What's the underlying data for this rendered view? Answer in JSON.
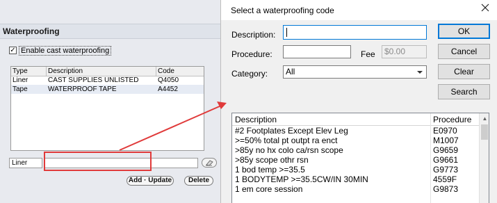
{
  "left_panel": {
    "section_title": "Waterproofing",
    "enable_checkbox": {
      "checked": true,
      "mark": "✓",
      "label": "Enable cast waterproofing"
    },
    "table": {
      "columns": [
        "Type",
        "Description",
        "Code"
      ],
      "rows": [
        {
          "type": "Liner",
          "description": "CAST SUPPLIES UNLISTED",
          "code": "Q4050"
        },
        {
          "type": "Tape",
          "description": "WATERPROOF TAPE",
          "code": "A4452"
        }
      ]
    },
    "type_value": "Liner",
    "description_value": "",
    "buttons": {
      "add_update": "Add · Update",
      "delete": "Delete"
    }
  },
  "dialog": {
    "title": "Select a waterproofing code",
    "close_glyph": "✕",
    "fields": {
      "description_label": "Description:",
      "description_value": "",
      "procedure_label": "Procedure:",
      "procedure_value": "",
      "fee_label": "Fee",
      "fee_placeholder": "$0.00",
      "category_label": "Category:",
      "category_value": "All"
    },
    "buttons": {
      "ok": "OK",
      "cancel": "Cancel",
      "clear": "Clear",
      "search": "Search"
    },
    "results": {
      "columns": [
        "Description",
        "Procedure"
      ],
      "rows": [
        {
          "description": "#2 Footplates Except Elev Leg",
          "procedure": "E0970"
        },
        {
          "description": ">=50% total pt outpt ra enct",
          "procedure": "M1007"
        },
        {
          "description": ">85y no hx colo ca/rsn scope",
          "procedure": "G9659"
        },
        {
          "description": ">85y scope othr rsn",
          "procedure": "G9661"
        },
        {
          "description": "1 bod temp >=35.5",
          "procedure": "G9773"
        },
        {
          "description": "1 BODYTEMP >=35.5CW/IN 30MIN",
          "procedure": "4559F"
        },
        {
          "description": "1 em core session",
          "procedure": "G9873"
        }
      ]
    }
  },
  "annotation": {
    "color": "#e03a3a"
  }
}
